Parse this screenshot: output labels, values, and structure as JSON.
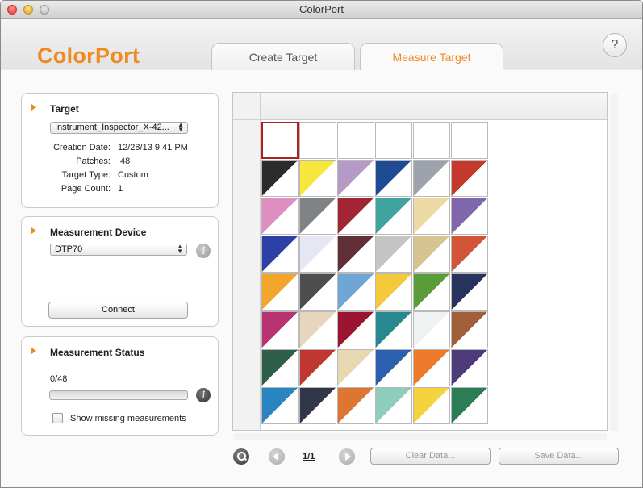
{
  "window": {
    "title": "ColorPort"
  },
  "header": {
    "logo": "ColorPort",
    "tabs": [
      {
        "label": "Create Target",
        "active": false
      },
      {
        "label": "Measure Target",
        "active": true
      }
    ],
    "help_label": "?"
  },
  "target": {
    "title": "Target",
    "file": "Instrument_Inspector_X-42...",
    "creation_date_label": "Creation Date:",
    "creation_date": "12/28/13 9:41 PM",
    "patches_label": "Patches:",
    "patches": "48",
    "target_type_label": "Target Type:",
    "target_type": "Custom",
    "page_count_label": "Page Count:",
    "page_count": "1"
  },
  "device": {
    "title": "Measurement Device",
    "selected": "DTP70",
    "connect_label": "Connect",
    "info_icon": "info-icon"
  },
  "status": {
    "title": "Measurement Status",
    "count": "0/48",
    "progress": 0,
    "show_missing_label": "Show missing measurements",
    "show_missing_checked": false
  },
  "pager": {
    "page": "1/1",
    "clear_label": "Clear Data...",
    "save_label": "Save Data..."
  },
  "patch_colors": [
    [
      "#ffffff",
      "#ffffff",
      "#ffffff",
      "#ffffff",
      "#ffffff",
      "#ffffff"
    ],
    [
      "#2c2c2c",
      "#f6e73a",
      "#b59ac8",
      "#1f4a94",
      "#9ea3ab",
      "#c4392c"
    ],
    [
      "#de8fc0",
      "#7f8385",
      "#a22533",
      "#3fa39e",
      "#ecd9a3",
      "#7f66ad"
    ],
    [
      "#2c40a8",
      "#e5e8f3",
      "#602f37",
      "#c4c5c5",
      "#d5c48f",
      "#d2553a"
    ],
    [
      "#f2a72c",
      "#4d4e50",
      "#6fa6d4",
      "#f5c93c",
      "#5a9c37",
      "#27325e"
    ],
    [
      "#b73470",
      "#e6d6bb",
      "#9b1530",
      "#27898f",
      "#eff1f3",
      "#a05e39"
    ],
    [
      "#2f5e4a",
      "#c03631",
      "#e8d9b3",
      "#2c5fae",
      "#ee7a2c",
      "#4e3b7a"
    ],
    [
      "#2a84c0",
      "#323649",
      "#de7533",
      "#8ecdbc",
      "#f5d33c",
      "#2c7d55"
    ]
  ],
  "selected_patch": [
    0,
    0
  ]
}
